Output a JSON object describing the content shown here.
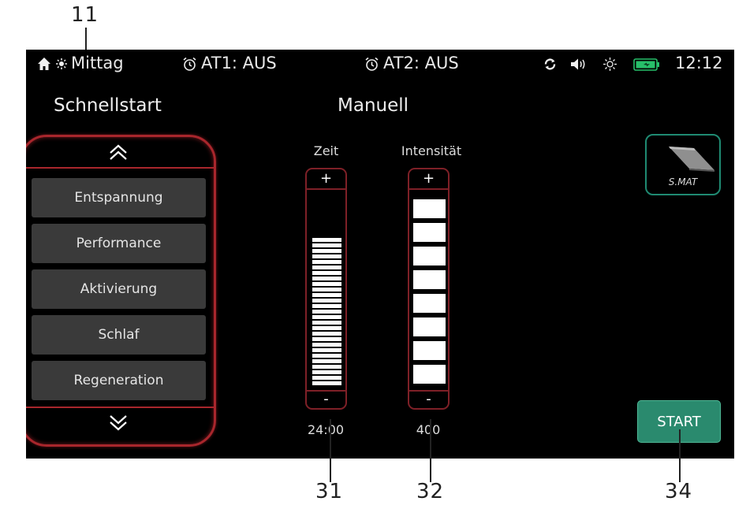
{
  "callouts": {
    "c11": "11",
    "c31": "31",
    "c32": "32",
    "c34": "34"
  },
  "statusbar": {
    "mode": "Mittag",
    "alarm1": "AT1: AUS",
    "alarm2": "AT2: AUS",
    "time": "12:12"
  },
  "quickstart": {
    "title": "Schnellstart",
    "items": [
      "Entspannung",
      "Performance",
      "Aktivierung",
      "Schlaf",
      "Regeneration"
    ]
  },
  "manual": {
    "title": "Manuell",
    "time": {
      "label": "Zeit",
      "plus": "+",
      "minus": "-",
      "value": "24:00",
      "level_bars": 27,
      "max_bars": 35
    },
    "intensity": {
      "label": "Intensität",
      "plus": "+",
      "minus": "-",
      "value": "400",
      "level_blocks": 8,
      "max_blocks": 8
    }
  },
  "device": {
    "label": "S.MAT"
  },
  "start": {
    "label": "START"
  },
  "colors": {
    "accent_red": "#a8262c",
    "accent_green": "#2a8a6e",
    "battery_green": "#27c06a"
  }
}
